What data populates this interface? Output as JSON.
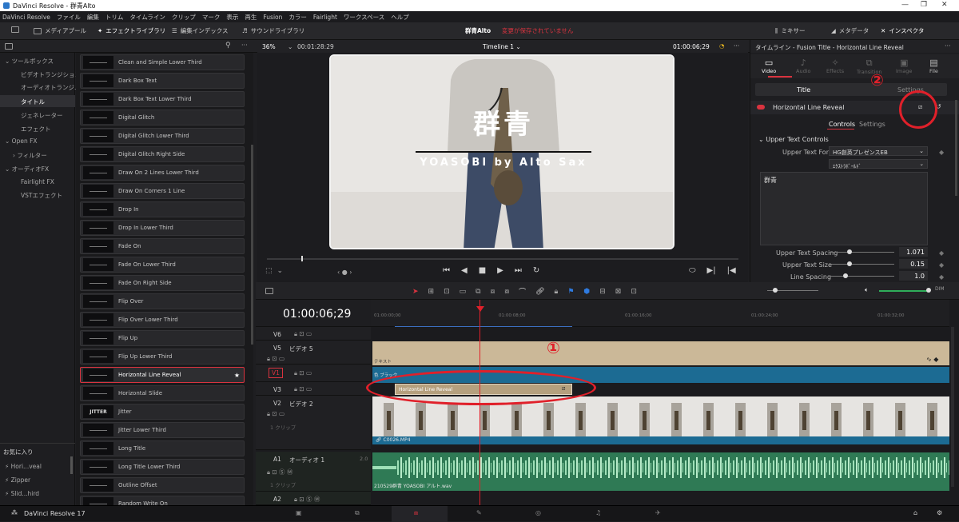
{
  "window": {
    "title": "DaVinci Resolve - 群青Alto",
    "controls": [
      "—",
      "❐",
      "✕"
    ]
  },
  "menu": [
    "DaVinci Resolve",
    "ファイル",
    "編集",
    "トリム",
    "タイムライン",
    "クリップ",
    "マーク",
    "表示",
    "再生",
    "Fusion",
    "カラー",
    "Fairlight",
    "ワークスペース",
    "ヘルプ"
  ],
  "toolbar": {
    "media_pool": "メディアプール",
    "effects_library": "エフェクトライブラリ",
    "edit_index": "編集インデックス",
    "sound_library": "サウンドライブラリ",
    "project": "群青Alto",
    "unsaved": "変更が保存されていません",
    "mixer": "ミキサー",
    "metadata": "メタデータ",
    "inspector": "インスペクタ"
  },
  "tree": {
    "toolbox": "ツールボックス",
    "video_transitions": "ビデオトランジション",
    "audio_transitions": "オーディオトランジ...",
    "titles": "タイトル",
    "generators": "ジェネレーター",
    "effects": "エフェクト",
    "openfx": "Open FX",
    "filters": "フィルター",
    "audiofx": "オーディオFX",
    "fairlight_fx": "Fairlight FX",
    "vst": "VSTエフェクト",
    "favorites": "お気に入り",
    "fav1": "Hori...veal",
    "fav2": "Zipper",
    "fav3": "Slid...hird"
  },
  "titles_list": [
    "Clean and Simple Lower Third",
    "Dark Box Text",
    "Dark Box Text Lower Third",
    "Digital Glitch",
    "Digital Glitch Lower Third",
    "Digital Glitch Right Side",
    "Draw On 2 Lines Lower Third",
    "Draw On Corners 1 Line",
    "Drop In",
    "Drop In Lower Third",
    "Fade On",
    "Fade On Lower Third",
    "Fade On Right Side",
    "Flip Over",
    "Flip Over Lower Third",
    "Flip Up",
    "Flip Up Lower Third",
    "Horizontal Line Reveal",
    "Horizontal Slide",
    "Jitter",
    "Jitter Lower Third",
    "Long Title",
    "Long Title Lower Third",
    "Outline Offset",
    "Random Write On"
  ],
  "thumb_labels": {
    "jitter": "JITTER"
  },
  "viewer": {
    "zoom": "36%",
    "src_tc": "00:01:28:29",
    "timeline": "Timeline 1",
    "rec_tc": "01:00:06;29",
    "overlay_title": "群青",
    "overlay_sub": "YOASOBI by Alto Sax"
  },
  "inspector": {
    "header": "タイムライン - Fusion Title - Horizontal Line Reveal",
    "tabs": [
      "Video",
      "Audio",
      "Effects",
      "Transition",
      "Image",
      "File"
    ],
    "subtabs": [
      "Title",
      "Settings"
    ],
    "effect_name": "Horizontal Line Reveal",
    "ctrl_tabs": [
      "Controls",
      "Settings"
    ],
    "section": "Upper Text Controls",
    "font_label": "Upper Text Font",
    "font_value": "HG創英プレゼンスEB",
    "font_style": "ｴｸｽﾄﾗﾎﾞｰﾙﾄﾞ",
    "text_value": "群青",
    "spacing_label": "Upper Text Spacing",
    "spacing_value": "1.071",
    "size_label": "Upper Text Size",
    "size_value": "0.15",
    "line_label": "Line Spacing",
    "line_value": "1.0"
  },
  "timeline": {
    "timecode": "01:00:06;29",
    "ruler": [
      "01:00:00;00",
      "01:00:08;00",
      "01:00:16;00",
      "01:00:24;00",
      "01:00:32;00"
    ],
    "v6": "V6",
    "v5": "V5",
    "v5_name": "ビデオ 5",
    "v4": "V1",
    "v3": "V3",
    "v2": "V2",
    "v2_name": "ビデオ 2",
    "v2_clips": "1 クリップ",
    "a1": "A1",
    "a1_name": "オーディオ 1",
    "a1_level": "2.0",
    "a1_clips": "1 クリップ",
    "a2": "A2",
    "title_clip": "テキスト",
    "tint_clip": "色 ブラック",
    "hlr_clip": "Horizontal Line Reveal",
    "video_clip": "C0026.MP4",
    "audio_clip": "210529群青 YOASOBI アルト.wav",
    "annotation1": "①",
    "annotation2": "②"
  },
  "bottom": {
    "app": "DaVinci Resolve 17"
  }
}
